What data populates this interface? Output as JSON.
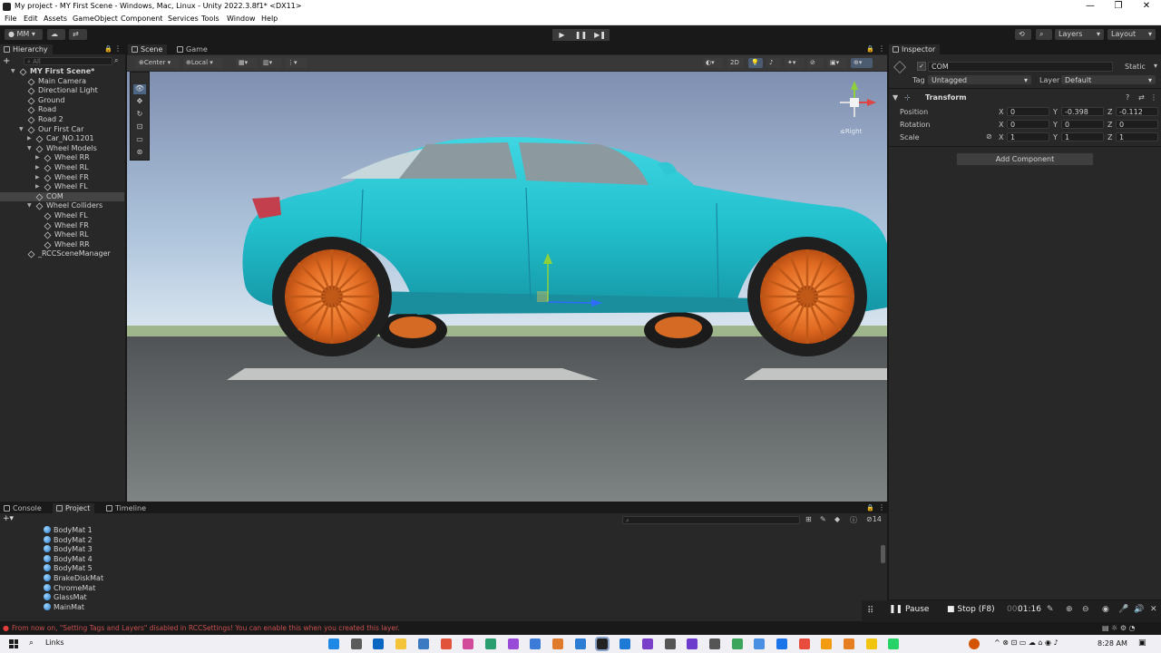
{
  "window": {
    "title": "My project - MY First Scene - Windows, Mac, Linux - Unity 2022.3.8f1* <DX11>",
    "controls": [
      "—",
      "❐",
      "✕"
    ]
  },
  "menu": [
    "File",
    "Edit",
    "Assets",
    "GameObject",
    "Component",
    "Services",
    "Tools",
    "Window",
    "Help"
  ],
  "toolbar": {
    "account": "MM",
    "layers": "Layers",
    "layout": "Layout",
    "play": "▶",
    "pause": "❚❚",
    "step": "▶❚"
  },
  "hierarchy": {
    "tab": "Hierarchy",
    "add": "+",
    "search_placeholder": "All",
    "items": [
      {
        "label": "MY First Scene*",
        "indent": 0,
        "arrow": "▼",
        "bold": true
      },
      {
        "label": "Main Camera",
        "indent": 1
      },
      {
        "label": "Directional Light",
        "indent": 1
      },
      {
        "label": "Ground",
        "indent": 1
      },
      {
        "label": "Road",
        "indent": 1
      },
      {
        "label": "Road 2",
        "indent": 1
      },
      {
        "label": "Our First Car",
        "indent": 1,
        "arrow": "▼"
      },
      {
        "label": "Car_NO.1201",
        "indent": 2,
        "arrow": "▶"
      },
      {
        "label": "Wheel Models",
        "indent": 2,
        "arrow": "▼"
      },
      {
        "label": "Wheel RR",
        "indent": 3,
        "arrow": "▶"
      },
      {
        "label": "Wheel RL",
        "indent": 3,
        "arrow": "▶"
      },
      {
        "label": "Wheel FR",
        "indent": 3,
        "arrow": "▶"
      },
      {
        "label": "Wheel FL",
        "indent": 3,
        "arrow": "▶"
      },
      {
        "label": "COM",
        "indent": 2,
        "selected": true
      },
      {
        "label": "Wheel Colliders",
        "indent": 2,
        "arrow": "▼"
      },
      {
        "label": "Wheel FL",
        "indent": 3
      },
      {
        "label": "Wheel FR",
        "indent": 3
      },
      {
        "label": "Wheel RL",
        "indent": 3
      },
      {
        "label": "Wheel RR",
        "indent": 3
      },
      {
        "label": "_RCCSceneManager",
        "indent": 1
      }
    ]
  },
  "scene": {
    "tabs": [
      "Scene",
      "Game"
    ],
    "pivot": "Center",
    "space": "Local",
    "mode_2d": "2D",
    "gizmo_label": "Right"
  },
  "inspector": {
    "tab": "Inspector",
    "object_name": "COM",
    "static_label": "Static",
    "tag_label": "Tag",
    "tag_value": "Untagged",
    "layer_label": "Layer",
    "layer_value": "Default",
    "component": "Transform",
    "position_label": "Position",
    "rotation_label": "Rotation",
    "scale_label": "Scale",
    "position": {
      "x": "0",
      "y": "-0.398",
      "z": "-0.112"
    },
    "rotation": {
      "x": "0",
      "y": "0",
      "z": "0"
    },
    "scale": {
      "x": "1",
      "y": "1",
      "z": "1"
    },
    "axis": {
      "x": "X",
      "y": "Y",
      "z": "Z"
    },
    "add_component": "Add Component"
  },
  "bottom": {
    "tabs": [
      "Console",
      "Project",
      "Timeline"
    ],
    "assets": [
      "BodyMat 1",
      "BodyMat 2",
      "BodyMat 3",
      "BodyMat 4",
      "BodyMat 5",
      "BrakeDiskMat",
      "ChromeMat",
      "GlassMat",
      "MainMat"
    ],
    "count": "14"
  },
  "capture_bar": {
    "pause": "Pause",
    "stop": "Stop",
    "stop_hint": "(F8)",
    "time_dim": "00:",
    "time": "01:16"
  },
  "status_message": "From now on, \"Setting Tags and Layers\" disabled in RCCSettings! You can enable this when you created this layer.",
  "taskbar": {
    "search_label": "Links",
    "clock": "8:28 AM"
  },
  "colors": {
    "car_body": "#1fc3cf",
    "rims": "#e4742a",
    "selection": "#444444",
    "error": "#e33d3d"
  }
}
